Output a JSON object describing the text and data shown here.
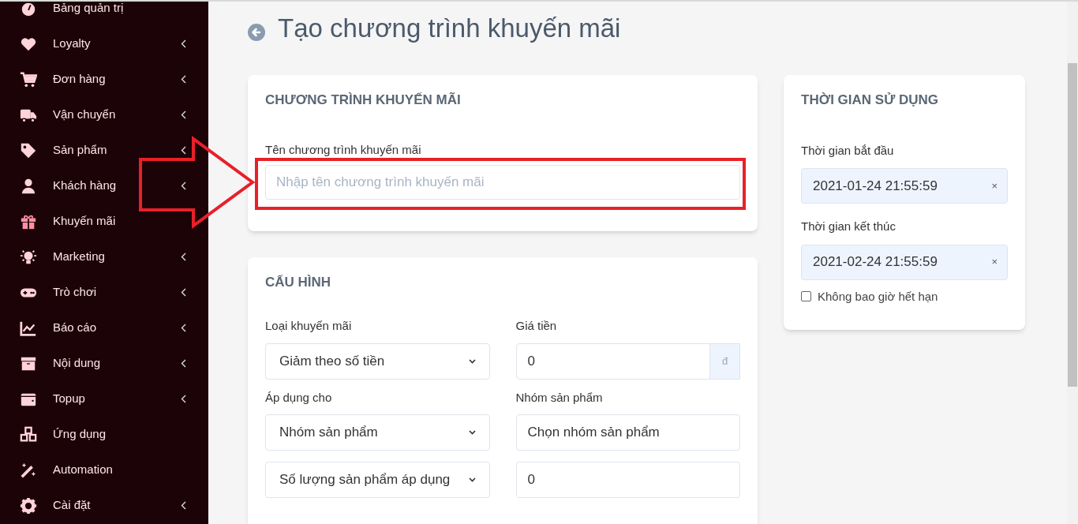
{
  "sidebar": {
    "items": [
      {
        "label": "Bảng quản trị",
        "has_submenu": false
      },
      {
        "label": "Loyalty",
        "has_submenu": true
      },
      {
        "label": "Đơn hàng",
        "has_submenu": true
      },
      {
        "label": "Vận chuyển",
        "has_submenu": true
      },
      {
        "label": "Sản phẩm",
        "has_submenu": true
      },
      {
        "label": "Khách hàng",
        "has_submenu": true
      },
      {
        "label": "Khuyến mãi",
        "has_submenu": false
      },
      {
        "label": "Marketing",
        "has_submenu": true
      },
      {
        "label": "Trò chơi",
        "has_submenu": true
      },
      {
        "label": "Báo cáo",
        "has_submenu": true
      },
      {
        "label": "Nội dung",
        "has_submenu": true
      },
      {
        "label": "Topup",
        "has_submenu": true
      },
      {
        "label": "Ứng dụng",
        "has_submenu": false
      },
      {
        "label": "Automation",
        "has_submenu": false
      },
      {
        "label": "Cài đặt",
        "has_submenu": true
      }
    ]
  },
  "page": {
    "title": "Tạo chương trình khuyến mãi"
  },
  "program_card": {
    "heading": "CHƯƠNG TRÌNH KHUYẾN MÃI",
    "field": {
      "label": "Tên chương trình khuyến mãi",
      "placeholder": "Nhập tên chương trình khuyến mãi"
    }
  },
  "config_card": {
    "heading": "CẤU HÌNH",
    "fields": [
      {
        "kind": "select",
        "label": "Loại khuyến mãi",
        "value": "Giảm theo số tiền"
      },
      {
        "kind": "addon",
        "label": "Giá tiền",
        "value": "0",
        "addon": "đ"
      },
      {
        "kind": "select",
        "label": "Áp dụng cho",
        "value": "Nhóm sản phẩm"
      },
      {
        "kind": "input",
        "label": "Nhóm sản phẩm",
        "value": "Chọn nhóm sản phẩm"
      },
      {
        "kind": "select",
        "value": "Số lượng sản phẩm áp dụng"
      },
      {
        "kind": "input",
        "value": "0"
      }
    ]
  },
  "time_card": {
    "heading": "THỜI GIAN SỬ DỤNG",
    "fields": [
      {
        "label": "Thời gian bắt đầu",
        "value": "2021-01-24 21:55:59",
        "clear": "×"
      },
      {
        "label": "Thời gian kết thúc",
        "value": "2021-02-24 21:55:59",
        "clear": "×"
      }
    ],
    "never_expire": {
      "label": "Không bao giờ hết hạn",
      "checked": false
    }
  }
}
